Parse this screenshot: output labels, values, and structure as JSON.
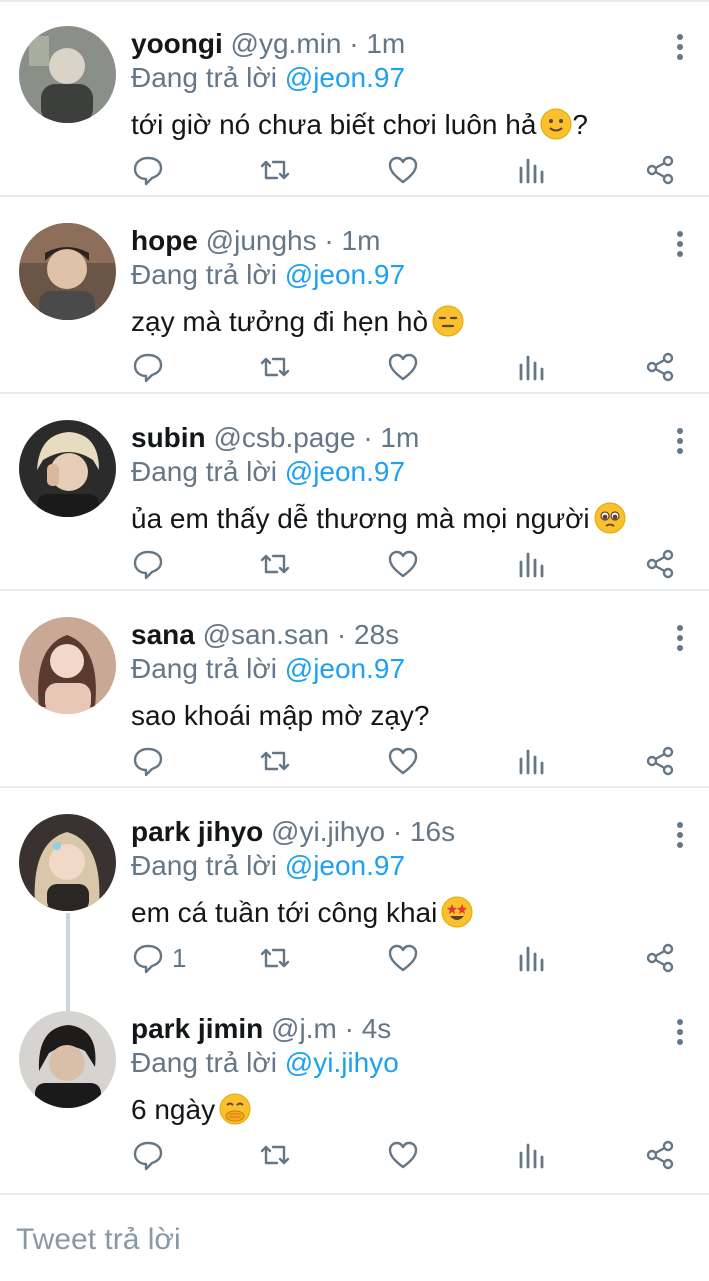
{
  "tweets": [
    {
      "name": "yoongi",
      "handle": "@yg.min",
      "dot": "·",
      "time": "1m",
      "replying_prefix": "Đang trả lời",
      "mention": "@jeon.97",
      "text": "tới giờ nó chưa biết chơi luôn hả",
      "emoji": "slightly-smiling-face",
      "text_suffix": "?",
      "reply_count": "",
      "avatar_bg": "#8a8f88"
    },
    {
      "name": "hope",
      "handle": "@junghs",
      "dot": "·",
      "time": "1m",
      "replying_prefix": "Đang trả lời",
      "mention": "@jeon.97",
      "text": "zạy mà tưởng đi hẹn hò",
      "emoji": "expressionless-face",
      "text_suffix": "",
      "reply_count": "",
      "avatar_bg": "#6b5546"
    },
    {
      "name": "subin",
      "handle": "@csb.page",
      "dot": "·",
      "time": "1m",
      "replying_prefix": "Đang trả lời",
      "mention": "@jeon.97",
      "text": "ủa em thấy dễ thương mà mọi người",
      "emoji": "pleading-face",
      "text_suffix": "",
      "reply_count": "",
      "avatar_bg": "#2b2b2b"
    },
    {
      "name": "sana",
      "handle": "@san.san",
      "dot": "·",
      "time": "28s",
      "replying_prefix": "Đang trả lời",
      "mention": "@jeon.97",
      "text": "sao khoái mập mờ zạy?",
      "emoji": "",
      "text_suffix": "",
      "reply_count": "",
      "avatar_bg": "#c9a896"
    },
    {
      "name": "park jihyo",
      "handle": "@yi.jihyo",
      "dot": "·",
      "time": "16s",
      "replying_prefix": "Đang trả lời",
      "mention": "@jeon.97",
      "text": "em cá tuần tới công khai",
      "emoji": "star-struck-face",
      "text_suffix": "",
      "reply_count": "1",
      "avatar_bg": "#3a3230"
    },
    {
      "name": "park jimin",
      "handle": "@j.m",
      "dot": "·",
      "time": "4s",
      "replying_prefix": "Đang trả lời",
      "mention": "@yi.jihyo",
      "text": "6 ngày",
      "emoji": "face-with-hand-over-mouth",
      "text_suffix": "",
      "reply_count": "",
      "avatar_bg": "#d6d4d0"
    }
  ],
  "compose": {
    "placeholder": "Tweet trả lời"
  },
  "colors": {
    "accent": "#1da1f2",
    "muted": "#657786",
    "divider": "#e6ecf0"
  }
}
